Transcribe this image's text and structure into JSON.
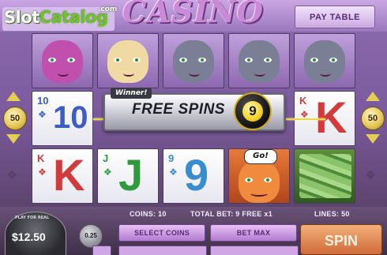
{
  "header": {
    "logo_slot": "Slot",
    "logo_catalog": "Catalog",
    "logo_com": ".com",
    "title": "CASINO",
    "paytable_label": "PAY TABLE"
  },
  "reels": {
    "row1": [
      "purple cat",
      "cream cat",
      "grey cat",
      "grey cat",
      "grey cat"
    ],
    "row2_cards": [
      {
        "rank": "10",
        "big": "10",
        "color": "blue"
      },
      {
        "rank": "K",
        "big": "K",
        "color": "red"
      }
    ],
    "row3_cards": [
      {
        "rank": "K",
        "big": "K",
        "color": "red"
      },
      {
        "rank": "J",
        "big": "J",
        "color": "green"
      },
      {
        "rank": "9",
        "big": "9",
        "color": "teal"
      }
    ]
  },
  "banner": {
    "winner_tag": "Winner!",
    "free_spins_label": "FREE SPINS",
    "spins_count": "9",
    "go_label": "Go!"
  },
  "lines": {
    "left_value": "50",
    "right_value": "50"
  },
  "bottom": {
    "play_real": "PLAY FOR REAL",
    "balance": "$12.50",
    "coin_value": "0.25",
    "coins": "COINS: 10",
    "total_bet": "TOTAL BET: 9 FREE x1",
    "lines_info": "LINES: 50",
    "select_coins": "SELECT COINS",
    "bet_max": "BET MAX",
    "spin": "SPIN"
  }
}
